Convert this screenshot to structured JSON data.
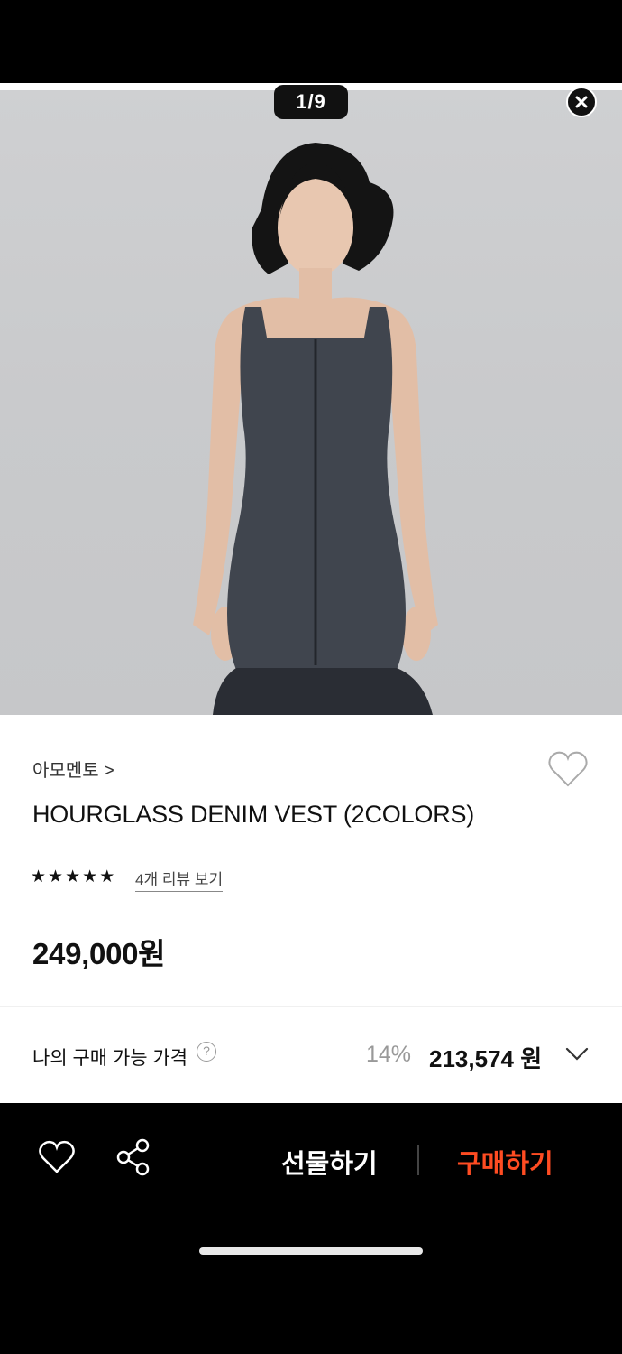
{
  "gallery": {
    "page_indicator": "1/9",
    "image_description_icon": "product-photo"
  },
  "product": {
    "brand": "아모멘토 >",
    "title": "HOURGLASS DENIM VEST (2COLORS)",
    "rating_stars": 5,
    "review_link": "4개 리뷰 보기",
    "price": "249,000원"
  },
  "my_price": {
    "label": "나의 구매 가능 가격",
    "help": "?",
    "discount": "14%",
    "final_price": "213,574 원"
  },
  "bottom_bar": {
    "gift": "선물하기",
    "buy": "구매하기"
  },
  "colors": {
    "accent": "#ff4c22",
    "background": "#000000"
  }
}
